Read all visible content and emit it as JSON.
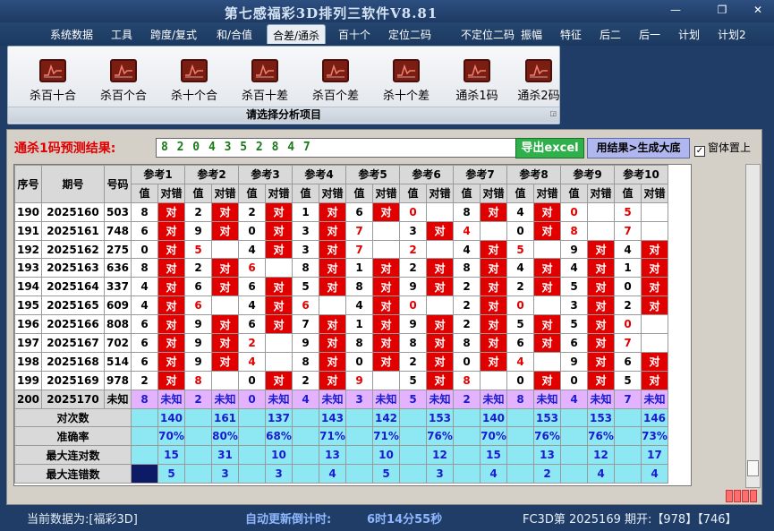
{
  "window": {
    "title": "第七感福彩3D排列三软件V8.81",
    "min": "—",
    "max": "❐",
    "close": "✕"
  },
  "menu": [
    "系统数据",
    "工具",
    "跨度/复式",
    "和/合值",
    "合差/通杀",
    "百十个",
    "定位二码",
    "不定位二码",
    "振幅",
    "特征",
    "后二",
    "后一",
    "计划",
    "计划2"
  ],
  "menu_active": 4,
  "ribbon": {
    "buttons": [
      "杀百十合",
      "杀百个合",
      "杀十个合",
      "杀百十差",
      "杀百个差",
      "杀十个差",
      "通杀1码",
      "通杀2码"
    ],
    "caption": "请选择分析项目"
  },
  "prediction": {
    "label": "通杀1码预测结果:",
    "value": "8 2 0 4 3 5 2 8 4 7",
    "export_label": "导出excel",
    "generate_label": "用结果>生成大底",
    "pin_label": "窗体置上",
    "pin_checked": "✓"
  },
  "table": {
    "headers": {
      "seq": "序号",
      "period": "期号",
      "code": "号码"
    },
    "refs": [
      "参考1",
      "参考2",
      "参考3",
      "参考4",
      "参考5",
      "参考6",
      "参考7",
      "参考8",
      "参考9",
      "参考10"
    ],
    "sub_value": "值",
    "sub_result": "对错",
    "rows": [
      {
        "seq": "190",
        "period": "2025160",
        "code": "503",
        "cells": [
          [
            "8",
            "对"
          ],
          [
            "2",
            "对"
          ],
          [
            "2",
            "对"
          ],
          [
            "1",
            "对"
          ],
          [
            "6",
            "对"
          ],
          [
            "0",
            ""
          ],
          [
            "8",
            "对"
          ],
          [
            "4",
            "对"
          ],
          [
            "0",
            ""
          ],
          [
            "5",
            ""
          ]
        ]
      },
      {
        "seq": "191",
        "period": "2025161",
        "code": "748",
        "cells": [
          [
            "6",
            "对"
          ],
          [
            "9",
            "对"
          ],
          [
            "0",
            "对"
          ],
          [
            "3",
            "对"
          ],
          [
            "7",
            ""
          ],
          [
            "3",
            "对"
          ],
          [
            "4",
            ""
          ],
          [
            "0",
            "对"
          ],
          [
            "8",
            ""
          ],
          [
            "7",
            ""
          ]
        ]
      },
      {
        "seq": "192",
        "period": "2025162",
        "code": "275",
        "cells": [
          [
            "0",
            "对"
          ],
          [
            "5",
            ""
          ],
          [
            "4",
            "对"
          ],
          [
            "3",
            "对"
          ],
          [
            "7",
            ""
          ],
          [
            "2",
            ""
          ],
          [
            "4",
            "对"
          ],
          [
            "5",
            ""
          ],
          [
            "9",
            "对"
          ],
          [
            "4",
            "对"
          ]
        ]
      },
      {
        "seq": "193",
        "period": "2025163",
        "code": "636",
        "cells": [
          [
            "8",
            "对"
          ],
          [
            "2",
            "对"
          ],
          [
            "6",
            ""
          ],
          [
            "8",
            "对"
          ],
          [
            "1",
            "对"
          ],
          [
            "2",
            "对"
          ],
          [
            "8",
            "对"
          ],
          [
            "4",
            "对"
          ],
          [
            "4",
            "对"
          ],
          [
            "1",
            "对"
          ]
        ]
      },
      {
        "seq": "194",
        "period": "2025164",
        "code": "337",
        "cells": [
          [
            "4",
            "对"
          ],
          [
            "6",
            "对"
          ],
          [
            "6",
            "对"
          ],
          [
            "5",
            "对"
          ],
          [
            "8",
            "对"
          ],
          [
            "9",
            "对"
          ],
          [
            "2",
            "对"
          ],
          [
            "2",
            "对"
          ],
          [
            "5",
            "对"
          ],
          [
            "0",
            "对"
          ]
        ]
      },
      {
        "seq": "195",
        "period": "2025165",
        "code": "609",
        "cells": [
          [
            "4",
            "对"
          ],
          [
            "6",
            ""
          ],
          [
            "4",
            "对"
          ],
          [
            "6",
            ""
          ],
          [
            "4",
            "对"
          ],
          [
            "0",
            ""
          ],
          [
            "2",
            "对"
          ],
          [
            "0",
            ""
          ],
          [
            "3",
            "对"
          ],
          [
            "2",
            "对"
          ]
        ]
      },
      {
        "seq": "196",
        "period": "2025166",
        "code": "808",
        "cells": [
          [
            "6",
            "对"
          ],
          [
            "9",
            "对"
          ],
          [
            "6",
            "对"
          ],
          [
            "7",
            "对"
          ],
          [
            "1",
            "对"
          ],
          [
            "9",
            "对"
          ],
          [
            "2",
            "对"
          ],
          [
            "5",
            "对"
          ],
          [
            "5",
            "对"
          ],
          [
            "0",
            ""
          ]
        ]
      },
      {
        "seq": "197",
        "period": "2025167",
        "code": "702",
        "cells": [
          [
            "6",
            "对"
          ],
          [
            "9",
            "对"
          ],
          [
            "2",
            ""
          ],
          [
            "9",
            "对"
          ],
          [
            "8",
            "对"
          ],
          [
            "8",
            "对"
          ],
          [
            "8",
            "对"
          ],
          [
            "6",
            "对"
          ],
          [
            "6",
            "对"
          ],
          [
            "7",
            ""
          ]
        ]
      },
      {
        "seq": "198",
        "period": "2025168",
        "code": "514",
        "cells": [
          [
            "6",
            "对"
          ],
          [
            "9",
            "对"
          ],
          [
            "4",
            ""
          ],
          [
            "8",
            "对"
          ],
          [
            "0",
            "对"
          ],
          [
            "2",
            "对"
          ],
          [
            "0",
            "对"
          ],
          [
            "4",
            ""
          ],
          [
            "9",
            "对"
          ],
          [
            "6",
            "对"
          ]
        ]
      },
      {
        "seq": "199",
        "period": "2025169",
        "code": "978",
        "cells": [
          [
            "2",
            "对"
          ],
          [
            "8",
            ""
          ],
          [
            "0",
            "对"
          ],
          [
            "2",
            "对"
          ],
          [
            "9",
            ""
          ],
          [
            "5",
            "对"
          ],
          [
            "8",
            ""
          ],
          [
            "0",
            "对"
          ],
          [
            "0",
            "对"
          ],
          [
            "5",
            "对"
          ]
        ]
      }
    ],
    "last_row": {
      "seq": "200",
      "period": "2025170",
      "code": "未知",
      "values": [
        "8",
        "2",
        "0",
        "4",
        "3",
        "5",
        "2",
        "8",
        "4",
        "7"
      ],
      "result": "未知"
    },
    "stats": [
      {
        "label": "对次数",
        "values": [
          "140",
          "161",
          "137",
          "143",
          "142",
          "153",
          "140",
          "153",
          "153",
          "146"
        ]
      },
      {
        "label": "准确率",
        "values": [
          "70%",
          "80%",
          "68%",
          "71%",
          "71%",
          "76%",
          "70%",
          "76%",
          "76%",
          "73%"
        ]
      },
      {
        "label": "最大连对数",
        "values": [
          "15",
          "31",
          "10",
          "13",
          "10",
          "12",
          "15",
          "13",
          "12",
          "17"
        ]
      },
      {
        "label": "最大连错数",
        "values": [
          "5",
          "3",
          "3",
          "4",
          "5",
          "3",
          "4",
          "2",
          "4",
          "4"
        ]
      }
    ]
  },
  "status": {
    "current": "当前数据为:[福彩3D]",
    "countdown_label": "自动更新倒计时:",
    "countdown": "6时14分55秒",
    "issue": "FC3D第 2025169 期开:【978】【746】"
  },
  "colors": {
    "hit": "#e00000",
    "stat_bg": "#8ee8f4",
    "last_row_bg": "#e4b3ff",
    "menu_bg": "#1f3d66"
  }
}
